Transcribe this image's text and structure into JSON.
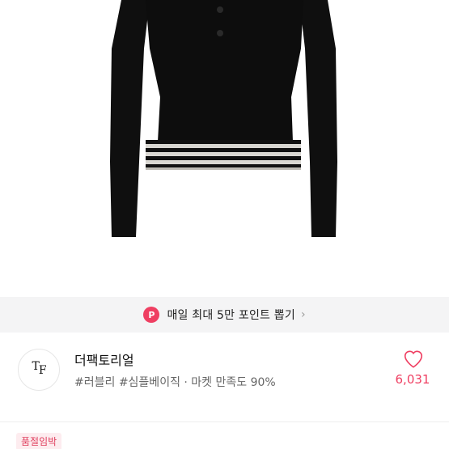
{
  "promo": {
    "badge": "P",
    "text": "매일 최대 5만 포인트 뽑기",
    "chevron": "›"
  },
  "store": {
    "logo_mark_t": "T",
    "logo_mark_f": "F",
    "name": "더팩토리얼",
    "tags": "#러블리 #심플베이직 · 마켓 만족도 90%",
    "like_count": "6,031",
    "heart_icon": "heart-outline-icon"
  },
  "product": {
    "status_badge": "품절임박"
  },
  "colors": {
    "accent": "#ef3f62",
    "banner_bg": "#f4f4f5",
    "garment": "#0d0d0d",
    "stripe_light": "#d9d7d2"
  }
}
